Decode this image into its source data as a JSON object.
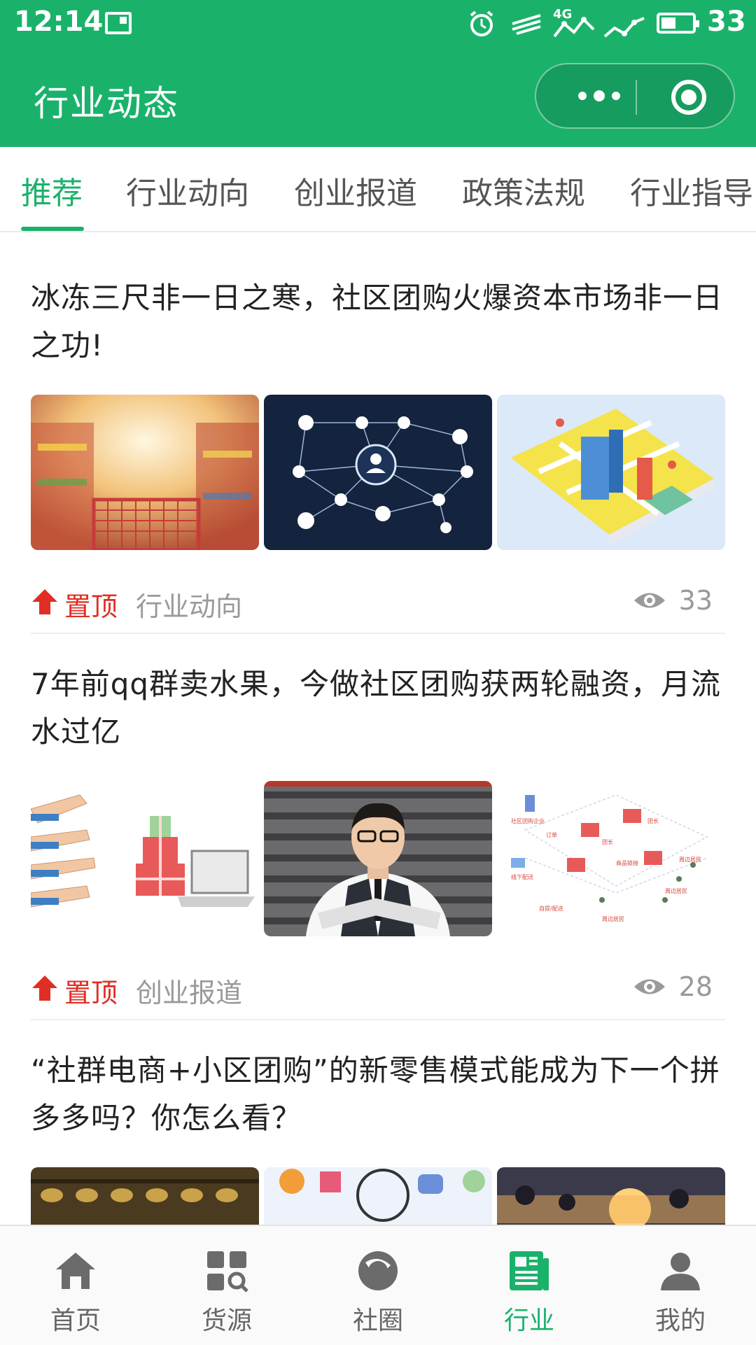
{
  "status_bar": {
    "time": "12:14",
    "network": "4G",
    "battery": "33"
  },
  "header": {
    "title": "行业动态",
    "brand_color": "#1ab26b"
  },
  "tabs": [
    {
      "label": "推荐",
      "active": true
    },
    {
      "label": "行业动向",
      "active": false
    },
    {
      "label": "创业报道",
      "active": false
    },
    {
      "label": "政策法规",
      "active": false
    },
    {
      "label": "行业指导",
      "active": false
    }
  ],
  "articles": [
    {
      "title": "冰冻三尺非一日之寒，社区团购火爆资本市场非一日之功!",
      "pin_label": "置顶",
      "category": "行业动向",
      "views": "33",
      "thumbnails": [
        "supermarket-cart-image",
        "network-nodes-image",
        "isometric-map-image"
      ]
    },
    {
      "title": "7年前qq群卖水果，今做社区团购获两轮融资，月流水过亿",
      "pin_label": "置顶",
      "category": "创业报道",
      "views": "28",
      "thumbnails": [
        "hands-gift-laptop-image",
        "man-portrait-image",
        "community-flow-diagram-image"
      ],
      "diagram_labels": [
        "社区团购企业",
        "订单",
        "团长",
        "线下配送",
        "商品链接",
        "周边居民",
        "团长",
        "周边居民",
        "自提/配送",
        "周边居民"
      ]
    },
    {
      "title": "“社群电商+小区团购”的新零售模式能成为下一个拼多多吗？你怎么看？",
      "thumbnails": [
        "abacus-image",
        "colorful-icons-image",
        "sunset-crowd-image"
      ]
    }
  ],
  "bottom_nav": [
    {
      "label": "首页",
      "icon": "home-icon",
      "active": false
    },
    {
      "label": "货源",
      "icon": "grid-search-icon",
      "active": false
    },
    {
      "label": "社圈",
      "icon": "circle-play-icon",
      "active": false
    },
    {
      "label": "行业",
      "icon": "document-icon",
      "active": true
    },
    {
      "label": "我的",
      "icon": "user-icon",
      "active": false
    }
  ]
}
